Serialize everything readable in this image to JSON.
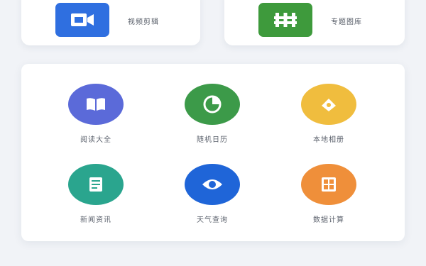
{
  "colors": {
    "video_blue": "#2f6fe0",
    "topic_green": "#3e9a3c",
    "purple_blue": "#5b6ad9",
    "green": "#3c9a49",
    "yellow": "#f0bd3e",
    "teal": "#2aa58e",
    "blue": "#1f65d8",
    "orange": "#ef8f3a"
  },
  "top_cards": [
    {
      "label": "视频剪辑",
      "icon": "video-camera-icon"
    },
    {
      "label": "专题图库",
      "icon": "fence-icon"
    }
  ],
  "tiles": [
    {
      "label": "阅读大全",
      "icon": "open-book-icon"
    },
    {
      "label": "随机日历",
      "icon": "pie-chart-icon"
    },
    {
      "label": "本地相册",
      "icon": "photo-album-icon"
    },
    {
      "label": "新闻资讯",
      "icon": "news-list-icon"
    },
    {
      "label": "天气查询",
      "icon": "eye-icon"
    },
    {
      "label": "数据计算",
      "icon": "calculator-icon"
    }
  ]
}
